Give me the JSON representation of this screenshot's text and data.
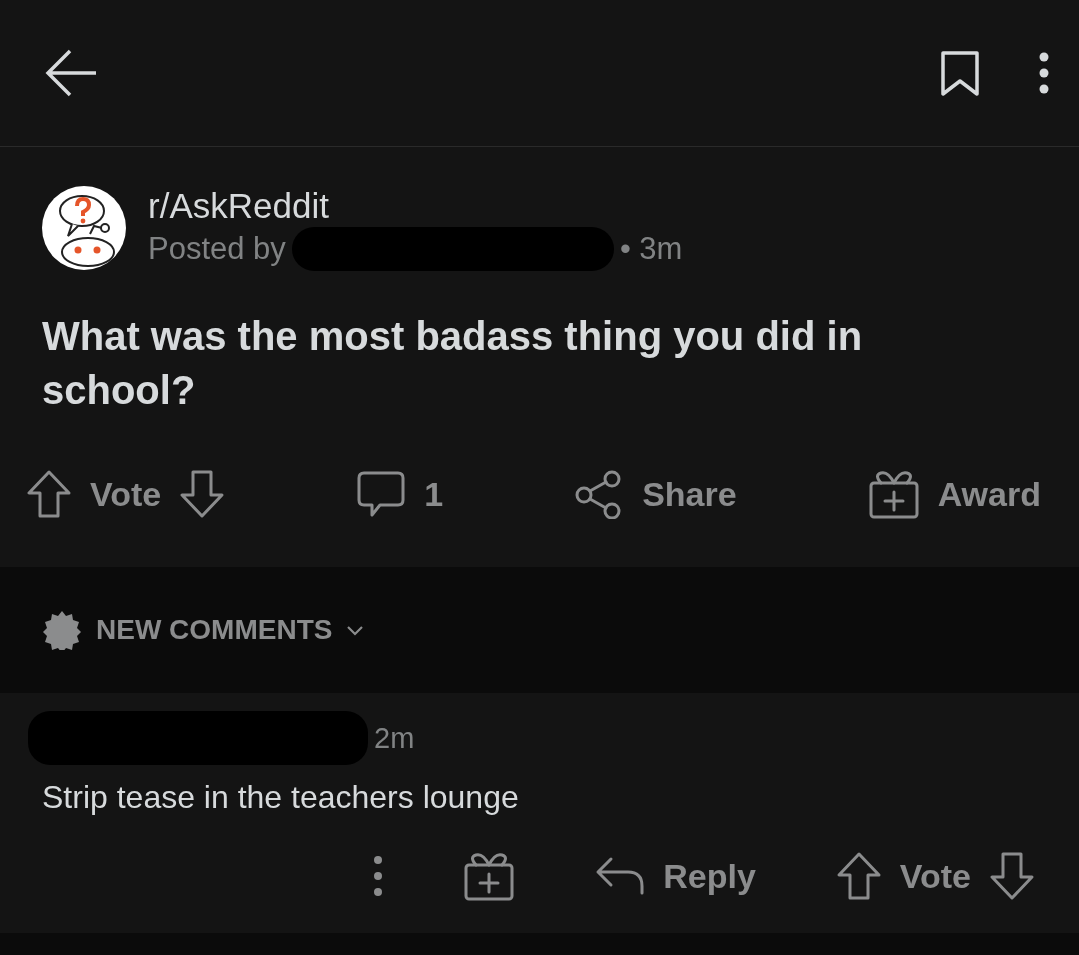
{
  "post": {
    "subreddit": "r/AskReddit",
    "posted_by": "Posted by",
    "age": "• 3m",
    "title": "What was the most badass thing you did in school?"
  },
  "post_actions": [
    {
      "kind": "vote",
      "label": "Vote"
    },
    {
      "kind": "comments",
      "label": "1"
    },
    {
      "kind": "share",
      "label": "Share"
    },
    {
      "kind": "award",
      "label": "Award"
    }
  ],
  "sort": {
    "label": "NEW COMMENTS"
  },
  "comments": [
    {
      "age": "2m",
      "body": "Strip tease in the teachers lounge",
      "actions": [
        {
          "kind": "more"
        },
        {
          "kind": "award"
        },
        {
          "kind": "reply",
          "label": "Reply"
        },
        {
          "kind": "vote",
          "label": "Vote"
        }
      ]
    }
  ]
}
